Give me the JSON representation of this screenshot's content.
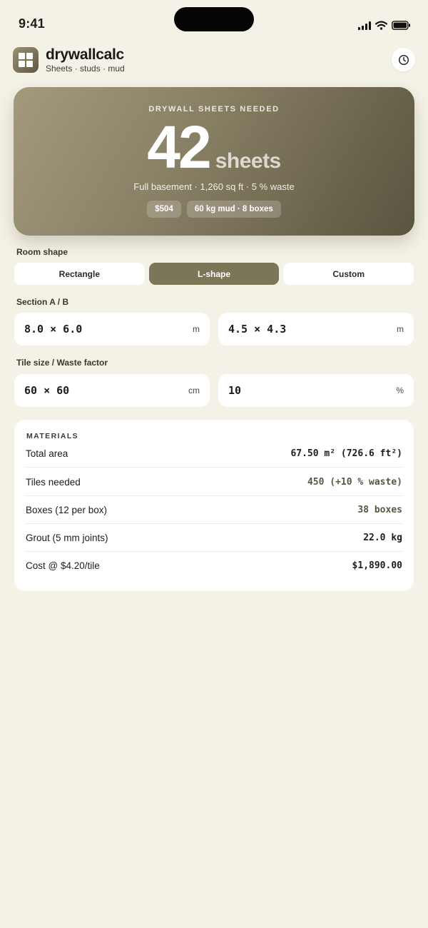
{
  "status_bar": {
    "time": "9:41"
  },
  "header": {
    "title": "drywallcalc",
    "subtitle": "Sheets · studs · mud",
    "history_icon": "clock-icon"
  },
  "hero": {
    "label": "DRYWALL SHEETS NEEDED",
    "value": "42",
    "unit": "sheets",
    "detail": "Full basement · 1,260 sq ft · 5 % waste",
    "chips": [
      "$504",
      "60 kg mud · 8 boxes"
    ]
  },
  "room_shape": {
    "label": "Room shape",
    "options": [
      "Rectangle",
      "L-shape",
      "Custom"
    ],
    "selected": "L-shape"
  },
  "sections": {
    "label": "Section A / B",
    "a": {
      "value": "8.0 × 6.0",
      "unit": "m"
    },
    "b": {
      "value": "4.5 × 4.3",
      "unit": "m"
    }
  },
  "tile_waste": {
    "label": "Tile size / Waste factor",
    "tile": {
      "value": "60 × 60",
      "unit": "cm"
    },
    "waste": {
      "value": "10",
      "unit": "%"
    }
  },
  "materials": {
    "title": "MATERIALS",
    "rows": [
      {
        "label": "Total area",
        "value": "67.50 m² (726.6 ft²)"
      },
      {
        "label": "Tiles needed",
        "value": "450 (+10 % waste)"
      },
      {
        "label": "Boxes (12 per box)",
        "value": "38 boxes"
      },
      {
        "label": "Grout (5 mm joints)",
        "value": "22.0 kg"
      },
      {
        "label": "Cost @ $4.20/tile",
        "value": "$1,890.00"
      }
    ]
  },
  "colors": {
    "background": "#f4f1e6",
    "accent": "#7c7658",
    "hero_start": "#a39a7e",
    "hero_end": "#5a543f"
  }
}
